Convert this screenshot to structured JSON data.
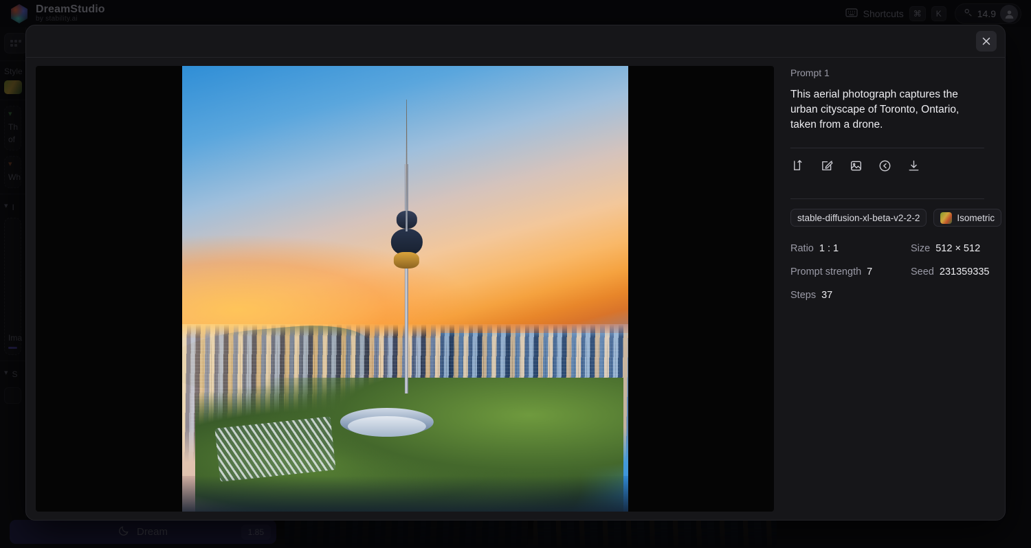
{
  "app": {
    "brand_title": "DreamStudio",
    "brand_subtitle": "by stability.ai",
    "shortcuts_label": "Shortcuts",
    "kbd_cmd": "⌘",
    "kbd_key": "K",
    "credits": "14.9"
  },
  "sidebar": {
    "style_label": "Style",
    "prompt_card_line1": "Th",
    "prompt_card_line2": "of",
    "negative_card_line1": "Wh",
    "image_section_label": "I",
    "upload_label": "Ima",
    "settings_section_label": "S"
  },
  "dream": {
    "label": "Dream",
    "cost": "1.85"
  },
  "modal": {
    "close_label": "×",
    "prompt_title": "Prompt 1",
    "prompt_text": "This aerial photograph captures the urban cityscape of Toronto, Ontario, taken from a drone.",
    "actions": [
      {
        "name": "branch-icon",
        "title": "Branch"
      },
      {
        "name": "edit-icon",
        "title": "Edit"
      },
      {
        "name": "image-icon",
        "title": "Image to image"
      },
      {
        "name": "reuse-settings-icon",
        "title": "Reuse settings"
      },
      {
        "name": "download-icon",
        "title": "Download"
      }
    ],
    "model_tag": "stable-diffusion-xl-beta-v2-2-2",
    "style_tag": "Isometric",
    "meta": [
      {
        "key": "Ratio",
        "value": "1 : 1"
      },
      {
        "key": "Size",
        "value": "512 × 512"
      },
      {
        "key": "Prompt strength",
        "value": "7"
      },
      {
        "key": "Seed",
        "value": "231359335"
      },
      {
        "key": "Steps",
        "value": "37"
      }
    ]
  },
  "colors": {
    "modal_bg": "#161619",
    "app_bg": "#0d0d0f",
    "accent_purple": "#211e47",
    "text_primary": "#ececf0",
    "text_muted": "#9a9aa6"
  }
}
